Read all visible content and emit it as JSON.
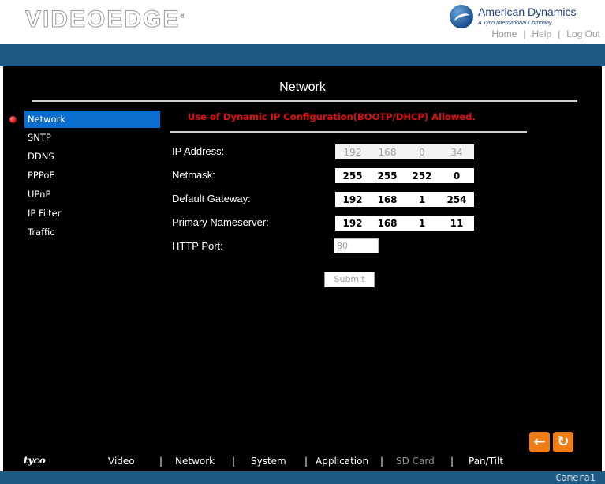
{
  "header": {
    "logo_text": "VIDEOEDGE",
    "logo_mark": "®",
    "brand_name": "American Dynamics",
    "brand_sub": "A Tyco International Company",
    "nav": [
      "Home",
      "Help",
      "Log Out"
    ]
  },
  "page_title": "Network",
  "sidebar": {
    "items": [
      {
        "label": "Network"
      },
      {
        "label": "SNTP"
      },
      {
        "label": "DDNS"
      },
      {
        "label": "PPPoE"
      },
      {
        "label": "UPnP"
      },
      {
        "label": "IP Filter"
      },
      {
        "label": "Traffic"
      }
    ]
  },
  "notice": "Use of Dynamic IP Configuration(BOOTP/DHCP) Allowed.",
  "form": {
    "ip_address": {
      "label": "IP Address:",
      "octets": [
        "192",
        "168",
        "0",
        "34"
      ]
    },
    "netmask": {
      "label": "Netmask:",
      "octets": [
        "255",
        "255",
        "252",
        "0"
      ]
    },
    "gateway": {
      "label": "Default Gateway:",
      "octets": [
        "192",
        "168",
        "1",
        "254"
      ]
    },
    "nameserver": {
      "label": "Primary Nameserver:",
      "octets": [
        "192",
        "168",
        "1",
        "11"
      ]
    },
    "http_port": {
      "label": "HTTP Port:",
      "value": "80"
    },
    "submit_label": "Submit"
  },
  "icons": {
    "back": "arrow-left-icon",
    "refresh": "refresh-icon"
  },
  "footer": {
    "brand": "tyco",
    "nav": [
      {
        "label": "Video"
      },
      {
        "label": "Network"
      },
      {
        "label": "System"
      },
      {
        "label": "Application"
      },
      {
        "label": "SD Card"
      },
      {
        "label": "Pan/Tilt"
      }
    ],
    "separator": "|",
    "camera": "Camera1"
  },
  "colors": {
    "accent_blue": "#1f5a85",
    "selection_blue": "#0a6ecf",
    "notice_red": "#e01010",
    "icon_orange": "#f07d14"
  }
}
